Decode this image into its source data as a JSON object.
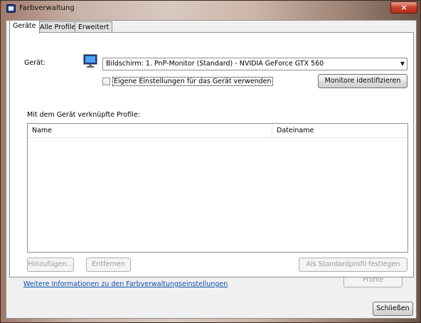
{
  "window": {
    "title": "Farbverwaltung",
    "close_glyph": "×"
  },
  "tabs": [
    {
      "label": "Geräte"
    },
    {
      "label": "Alle Profile"
    },
    {
      "label": "Erweitert"
    }
  ],
  "device": {
    "label": "Gerät:",
    "selected": "Bildschirm: 1. PnP-Monitor (Standard) - NVIDIA GeForce GTX 560",
    "checkbox_label": "Eigene Einstellungen für das Gerät verwenden",
    "checkbox_checked": false,
    "identify_button": "Monitore identifizieren"
  },
  "profiles": {
    "heading": "Mit dem Gerät verknüpfte Profile:",
    "columns": [
      "Name",
      "Dateiname"
    ],
    "rows": []
  },
  "buttons": {
    "add": "Hinzufügen...",
    "remove": "Entfernen",
    "set_default": "Als Standardprofil festlegen",
    "profiles": "Profile",
    "close": "Schließen"
  },
  "link_text": "Weitere Informationen zu den Farbverwaltungseinstellungen",
  "colors": {
    "link": "#0b4fad",
    "close_button": "#c6422a"
  },
  "icons": [
    "app-icon",
    "monitor-icon",
    "close-icon",
    "dropdown-arrow-icon"
  ]
}
